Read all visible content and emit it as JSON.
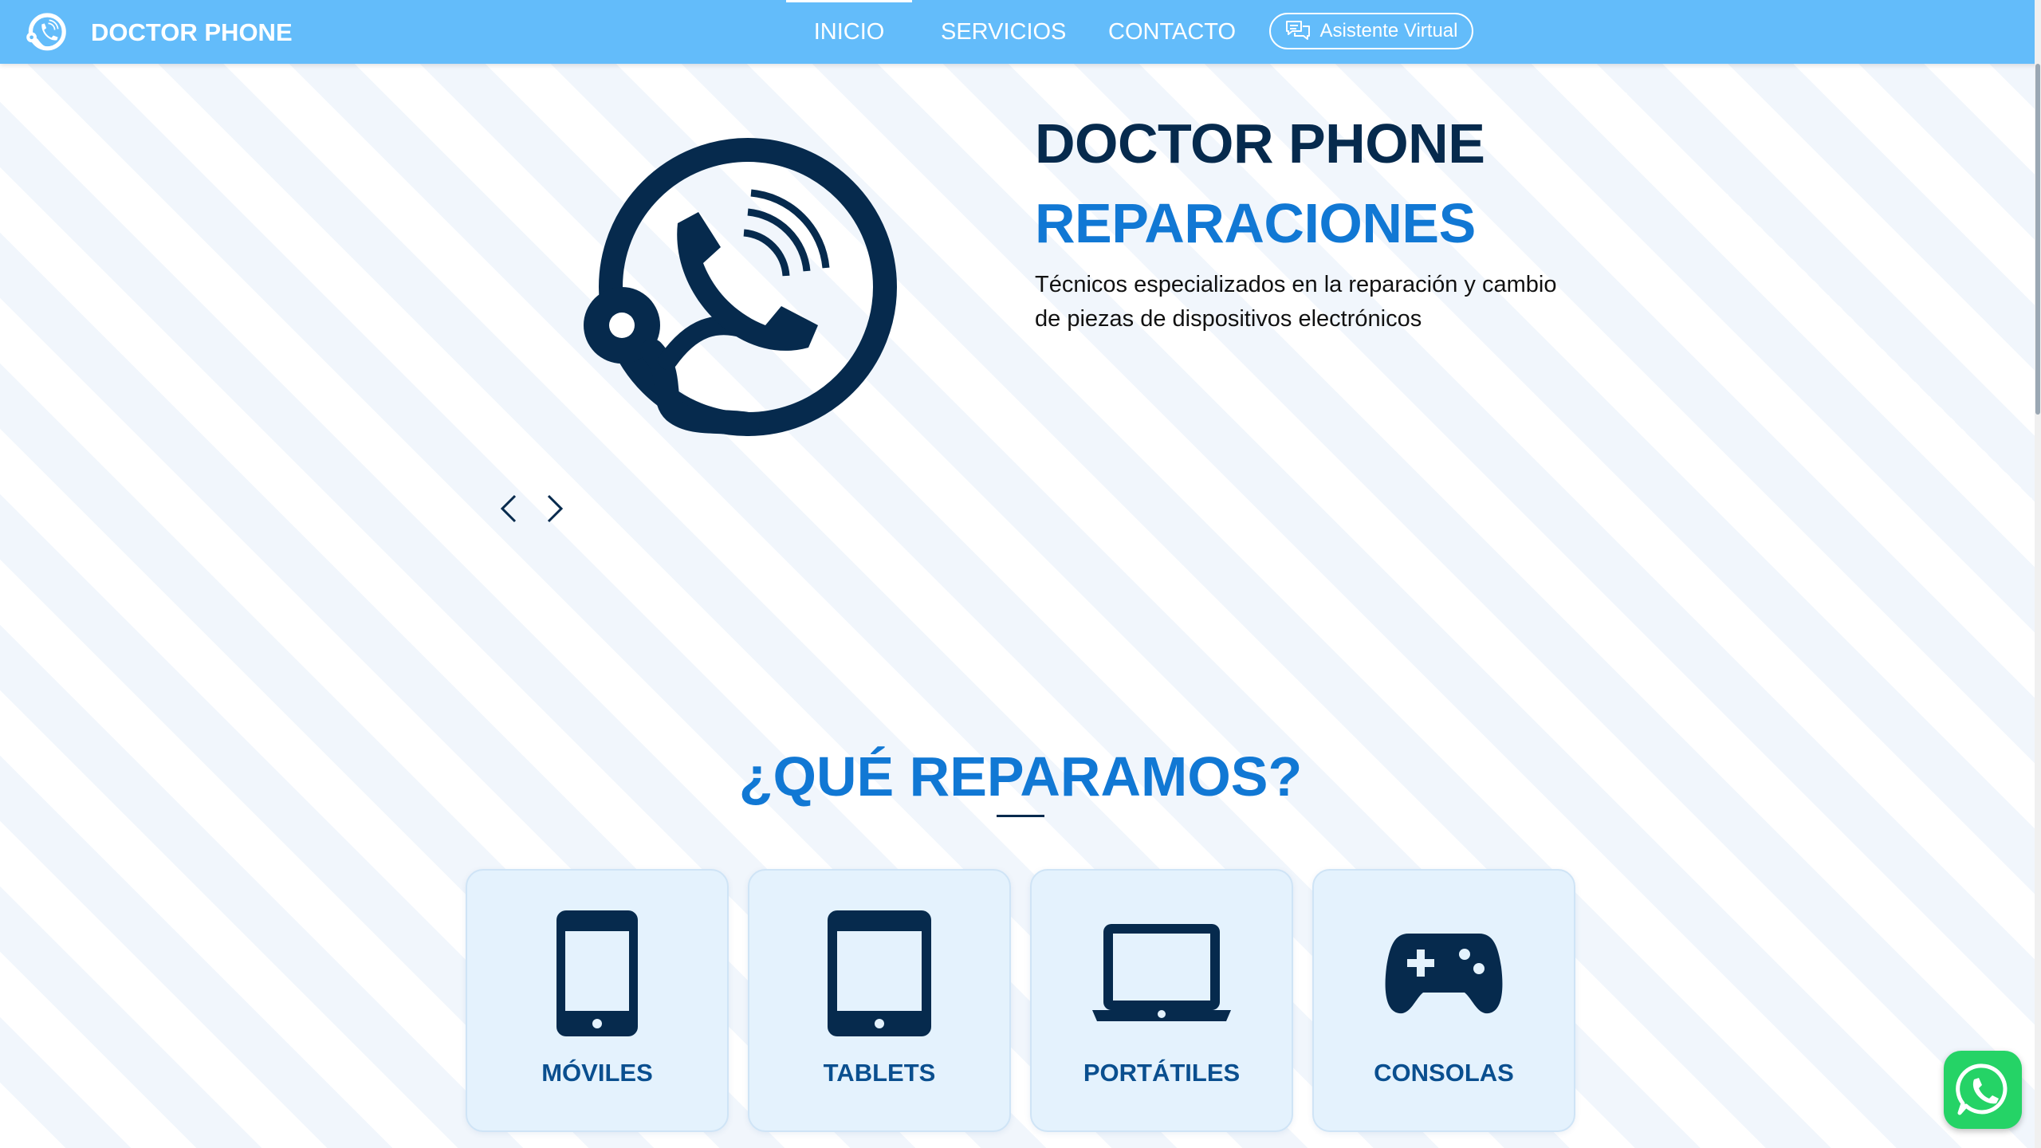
{
  "nav": {
    "brand": "DOCTOR PHONE",
    "links": [
      {
        "label": "INICIO"
      },
      {
        "label": "SERVICIOS"
      },
      {
        "label": "CONTACTO"
      }
    ],
    "active": "INICIO",
    "assistant_label": "Asistente Virtual"
  },
  "hero": {
    "title_line1": "DOCTOR PHONE",
    "title_line2": "REPARACIONES",
    "description": "Técnicos especializados en la reparación y cambio de piezas de dispositivos electrónicos",
    "logo_icon": "phone-support-icon",
    "carousel_controls": [
      "chevron-left-icon",
      "chevron-right-icon"
    ]
  },
  "section": {
    "title": "¿QUÉ REPARAMOS?",
    "cards": [
      {
        "label": "MÓVILES",
        "icon": "smartphone-icon"
      },
      {
        "label": "TABLETS",
        "icon": "tablet-icon"
      },
      {
        "label": "PORTÁTILES",
        "icon": "laptop-icon"
      },
      {
        "label": "CONSOLAS",
        "icon": "gamepad-icon"
      }
    ]
  },
  "floating": {
    "icon": "whatsapp-icon"
  },
  "colors": {
    "navbar": "#63bcfa",
    "dark_navy": "#062a4d",
    "accent_blue": "#1178d4",
    "card_bg": "#e4f2fd",
    "whatsapp_green": "#25d366"
  }
}
